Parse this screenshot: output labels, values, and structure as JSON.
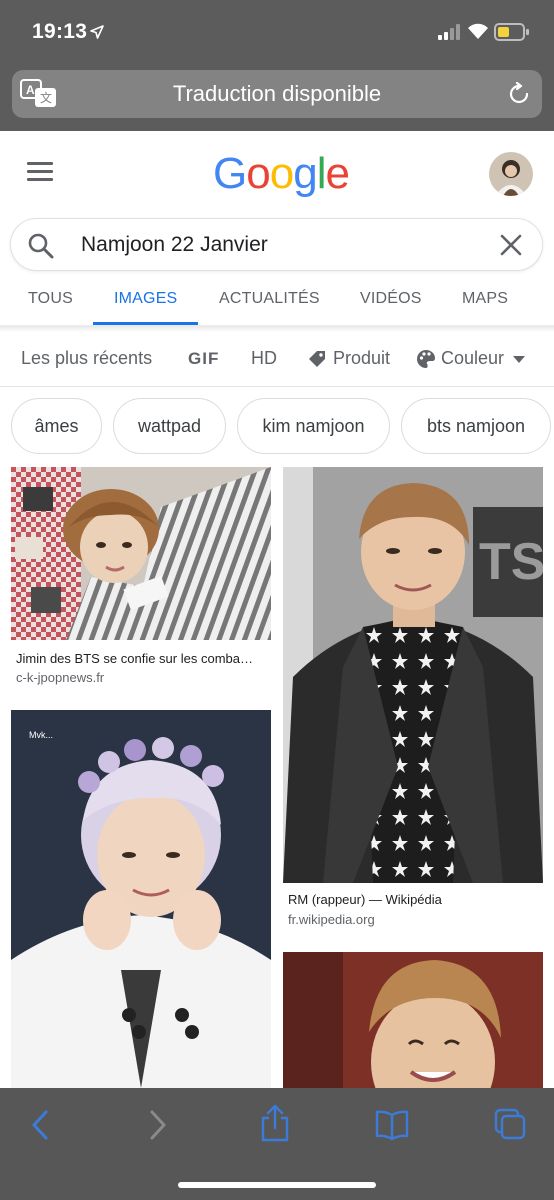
{
  "status_bar": {
    "time": "19:13"
  },
  "safari": {
    "banner_text": "Traduction disponible"
  },
  "google": {
    "logo": [
      "G",
      "o",
      "o",
      "g",
      "l",
      "e"
    ],
    "logo_colors": [
      "#4285f4",
      "#ea4335",
      "#fbbc05",
      "#4285f4",
      "#34a853",
      "#ea4335"
    ],
    "query": "Namjoon 22 Janvier"
  },
  "tabs": [
    "TOUS",
    "IMAGES",
    "ACTUALITÉS",
    "VIDÉOS",
    "MAPS"
  ],
  "active_tab": "IMAGES",
  "filters": {
    "recent": "Les plus récents",
    "gif": "GIF",
    "hd": "HD",
    "product": "Produit",
    "color": "Couleur"
  },
  "chips": [
    "âmes",
    "wattpad",
    "kim namjoon",
    "bts namjoon"
  ],
  "results": [
    {
      "title": "Jimin des BTS se confie sur les comba…",
      "site": "c-k-jpopnews.fr"
    },
    {
      "title": "RM (rappeur) — Wikipédia",
      "site": "fr.wikipedia.org"
    }
  ],
  "colors": {
    "accent": "#1a73e8",
    "safari_chrome": "#5c5c5c",
    "toolbar": "#575757",
    "toolbar_icon": "#3d7bd9"
  }
}
